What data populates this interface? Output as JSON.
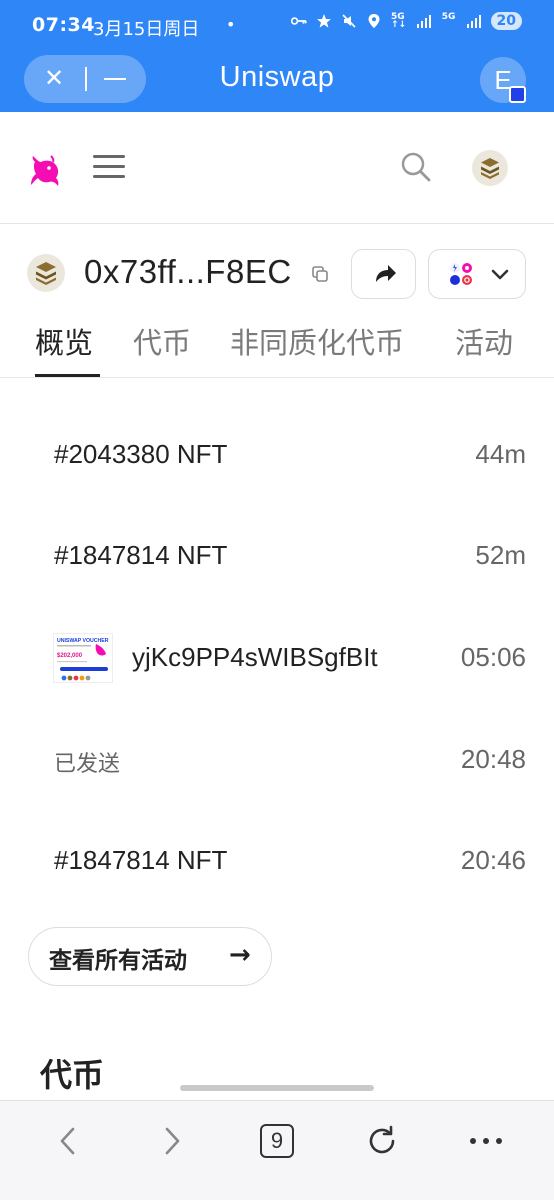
{
  "status_bar": {
    "time": "07:34",
    "date": "3月15日周日",
    "dot": "•",
    "battery": "20",
    "icons": [
      "key-icon",
      "star-icon",
      "mute-icon",
      "location-icon",
      "5g-icon",
      "signal-icon",
      "5g-icon",
      "signal-icon"
    ]
  },
  "browser": {
    "title": "Uniswap",
    "account_initial": "E",
    "accent_color": "#2F86F6"
  },
  "wallet": {
    "address": "0x73ff...F8EC"
  },
  "tabs": [
    {
      "label": "概览",
      "active": true
    },
    {
      "label": "代币",
      "active": false
    },
    {
      "label": "非同质化代币",
      "active": false
    },
    {
      "label": "活动",
      "active": false
    }
  ],
  "activity": [
    {
      "name": "#2043380 NFT",
      "time": "44m"
    },
    {
      "name": "#1847814 NFT",
      "time": "52m"
    },
    {
      "name": "yjKc9PP4sWIBSgfBIt",
      "time": "05:06",
      "thumbnail": {
        "title": "UNISWAP VOUCHER",
        "amount": "$202,000"
      }
    },
    {
      "name": "已发送",
      "time": "20:48"
    },
    {
      "name": "#1847814 NFT",
      "time": "20:46"
    }
  ],
  "view_all_label": "查看所有活动",
  "tokens_heading": "代币",
  "bottom_nav": {
    "tab_count": "9",
    "icons": [
      "back-icon",
      "forward-icon",
      "tabs-icon",
      "refresh-icon",
      "more-icon"
    ]
  }
}
